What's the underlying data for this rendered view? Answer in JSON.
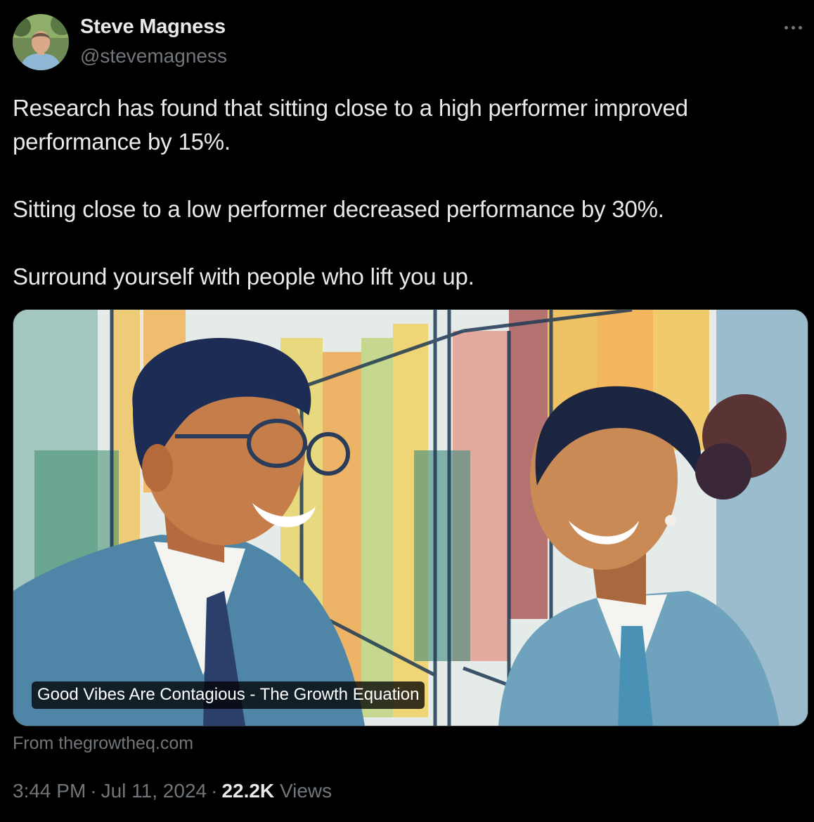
{
  "author": {
    "name": "Steve Magness",
    "handle": "@stevemagness"
  },
  "tweet": {
    "paragraphs": [
      "Research has found that sitting close to a high performer improved\nperformance by 15%.",
      "Sitting close to a low performer decreased performance by 30%.",
      "Surround yourself with people who lift you up."
    ]
  },
  "card": {
    "caption": "Good Vibes Are Contagious - The Growth Equation",
    "source": "From thegrowtheq.com"
  },
  "meta": {
    "time": "3:44 PM",
    "separator": "·",
    "date": "Jul 11, 2024",
    "views_count": "22.2K",
    "views_label": "Views"
  },
  "icons": {
    "more": "more-horizontal-icon"
  },
  "colors": {
    "background": "#000000",
    "primary_text": "#e7e9ea",
    "secondary_text": "#71767b",
    "border": "#2f3336"
  }
}
